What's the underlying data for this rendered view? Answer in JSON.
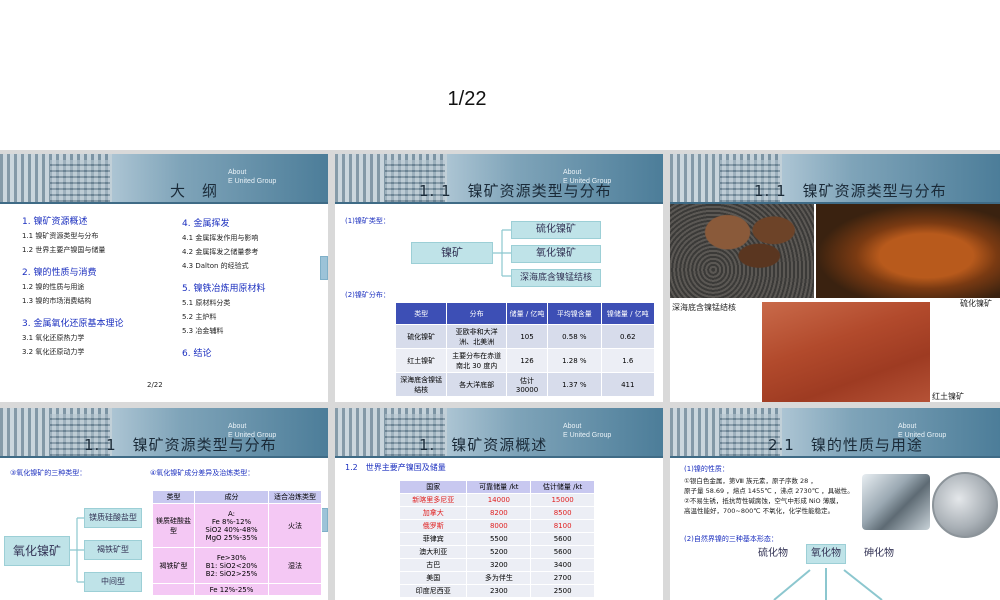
{
  "page_indicator": "1/22",
  "slide1": {
    "about": [
      "About",
      "E United Group"
    ],
    "title": "大　纲",
    "sec1": "1. 镍矿资源概述",
    "s11": "1.1  镍矿资源类型与分布",
    "s12": "1.2  世界主要产镍国与储量",
    "sec2": "2. 镍的性质与消费",
    "s21": "1.2  镍的性质与用途",
    "s22": "1.3  镍的市场消费结构",
    "sec3": "3. 金属氧化还原基本理论",
    "s31": "3.1  氧化还原热力学",
    "s32": "3.2  氧化还原动力学",
    "sec4": "4. 金属挥发",
    "s41": "4.1  金属挥发作用与影响",
    "s42": "4.2  金属挥发之储量参考",
    "s43": "4.3 Dalton 的经验式",
    "sec5": "5. 镍铁冶炼用原材料",
    "s51": "5.1  原材料分类",
    "s52": "5.2  主炉料",
    "s53": "5.3  冶金辅料",
    "sec6": "6. 结论",
    "page": "2/22"
  },
  "slide2": {
    "about": [
      "About",
      "E United Group"
    ],
    "title": "1. 1　镍矿资源类型与分布",
    "types_label": "(1)镍矿类型：",
    "root": "镍矿",
    "branches": [
      "硫化镍矿",
      "氧化镍矿",
      "深海底含镍锰结核"
    ],
    "dist_label": "(2)镍矿分布：",
    "headers": [
      "类型",
      "分布",
      "储量 / 亿吨",
      "平均镍含量",
      "镍储量 / 亿吨"
    ],
    "rows": [
      [
        "硫化镍矿",
        "亚欧非和大洋洲、北美洲",
        "105",
        "0.58 %",
        "0.62"
      ],
      [
        "红土镍矿",
        "主要分布在赤道南北 30 度内",
        "126",
        "1.28 %",
        "1.6"
      ],
      [
        "深海底含镍锰结核",
        "各大洋底部",
        "估计 30000",
        "1.37 %",
        "411"
      ]
    ]
  },
  "slide3": {
    "title": "1. 1　镍矿资源类型与分布",
    "cap1": "深海底含镍锰结核",
    "cap2": "硫化镍矿",
    "cap3": "红土镍矿"
  },
  "slide4": {
    "about": [
      "About",
      "E United Group"
    ],
    "title": "1. 1　镍矿资源类型与分布",
    "left_label": "③氧化镍矿的三种类型：",
    "right_label": "④氧化镍矿成分差异及治炼类型：",
    "root": "氧化镍矿",
    "branches": [
      "镁质硅酸盐型",
      "褐铁矿型",
      "中间型"
    ],
    "headers": [
      "类型",
      "成分",
      "适合冶炼类型"
    ],
    "rows": [
      [
        "镁质硅酸盐型",
        "A:\nFe 8%-12%\nSiO2 40%-48%\nMgO 25%-35%",
        "火法"
      ],
      [
        "褐铁矿型",
        "Fe>30%\nB1: SiO2<20%\nB2: SiO2>25%",
        "湿法"
      ],
      [
        "",
        "Fe 12%-25%",
        ""
      ]
    ]
  },
  "slide5": {
    "about": [
      "About",
      "E United Group"
    ],
    "title": "1.　镍矿资源概述",
    "subtitle": "1.2　世界主要产镍国及储量",
    "headers": [
      "国家",
      "可靠储量 /kt",
      "估计储量 /kt"
    ],
    "rows": [
      [
        "新喀里多尼亚",
        "14000",
        "15000"
      ],
      [
        "加拿大",
        "8200",
        "8500"
      ],
      [
        "俄罗斯",
        "8000",
        "8100"
      ],
      [
        "菲律宾",
        "5500",
        "5600"
      ],
      [
        "澳大利亚",
        "5200",
        "5600"
      ],
      [
        "古巴",
        "3200",
        "3400"
      ],
      [
        "美国",
        "多为伴生",
        "2700"
      ],
      [
        "印度尼西亚",
        "2300",
        "2500"
      ]
    ]
  },
  "slide6": {
    "about": [
      "About",
      "E United Group"
    ],
    "title": "2.1　镍的性质与用途",
    "p_label": "(1)镍的性质：",
    "p1": "①银白色金属，第Ⅷ 族元素，原子序数 28 ，",
    "p2": "原子量 58.69 ，熔点 1455℃ ，沸点 2730℃ ，具磁性。",
    "p3": "②不易生锈，抵抗苛性碱腐蚀，空气中形成  NiO 薄膜，",
    "p4": "高温性能好，700~800℃ 不氧化，化学性能稳定。",
    "forms_label": "(2)自然界镍的三种基本形态：",
    "forms": [
      "硫化物",
      "氧化物",
      "砷化物"
    ]
  }
}
